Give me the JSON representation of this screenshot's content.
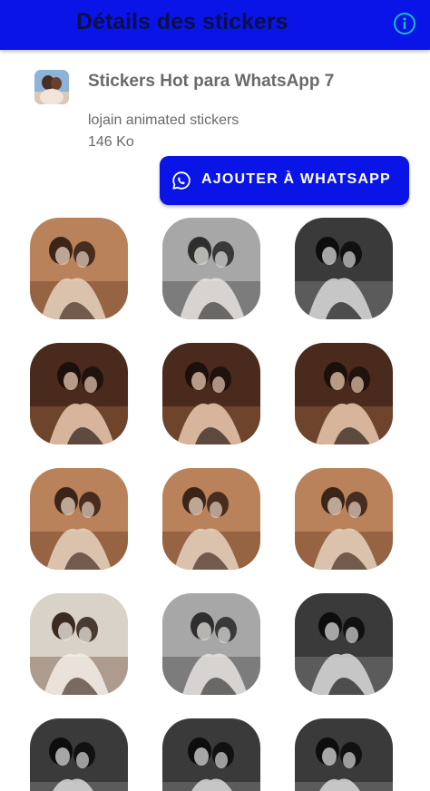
{
  "appbar": {
    "title": "Détails des stickers",
    "info_icon": "info-icon",
    "background": "#0a14e6"
  },
  "pack": {
    "name": "Stickers Hot para WhatsApp 7",
    "publisher": "lojain animated stickers",
    "size": "146 Ko",
    "tray_icon": "pack-tray-image"
  },
  "add_button": {
    "label": "AJOUTER À WHATSAPP",
    "icon": "whatsapp-icon",
    "color": "#0a14e6"
  },
  "stickers": [
    {
      "tone": "warm"
    },
    {
      "tone": "gray"
    },
    {
      "tone": "bw"
    },
    {
      "tone": "dark-warm"
    },
    {
      "tone": "dark-warm"
    },
    {
      "tone": "dark-warm"
    },
    {
      "tone": "warm"
    },
    {
      "tone": "warm"
    },
    {
      "tone": "warm"
    },
    {
      "tone": "light"
    },
    {
      "tone": "gray"
    },
    {
      "tone": "bw"
    },
    {
      "tone": "bw"
    },
    {
      "tone": "bw"
    },
    {
      "tone": "bw"
    }
  ]
}
